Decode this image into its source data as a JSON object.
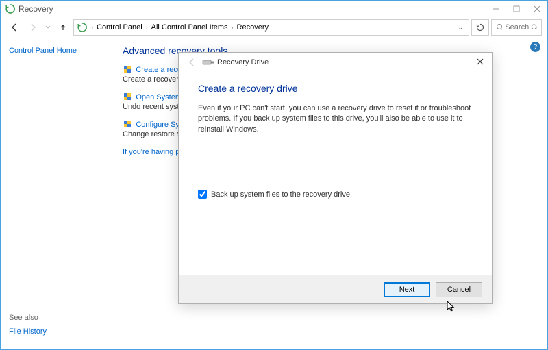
{
  "window": {
    "title": "Recovery"
  },
  "address": {
    "items": [
      "Control Panel",
      "All Control Panel Items",
      "Recovery"
    ]
  },
  "search": {
    "placeholder": "Search Co..."
  },
  "sidebar": {
    "home_link": "Control Panel Home",
    "seealso_heading": "See also",
    "seealso_link": "File History"
  },
  "content": {
    "heading": "Advanced recovery tools",
    "tools": [
      {
        "link": "Create a recovery drive",
        "desc": "Create a recovery drive to troubleshoot problems when your PC can't start."
      },
      {
        "link": "Open System Restore",
        "desc": "Undo recent system changes, but leave files such as documents, pictures, and music unchanged."
      },
      {
        "link": "Configure System Restore",
        "desc": "Change restore settings, manage disk space, and create or delete restore points."
      }
    ],
    "problems_link": "If you're having problems with your PC, go to Settings and try resetting it"
  },
  "dialog": {
    "title": "Recovery Drive",
    "heading": "Create a recovery drive",
    "description": "Even if your PC can't start, you can use a recovery drive to reset it or troubleshoot problems. If you back up system files to this drive, you'll also be able to use it to reinstall Windows.",
    "checkbox_label": "Back up system files to the recovery drive.",
    "checkbox_checked": true,
    "next_label": "Next",
    "cancel_label": "Cancel"
  }
}
